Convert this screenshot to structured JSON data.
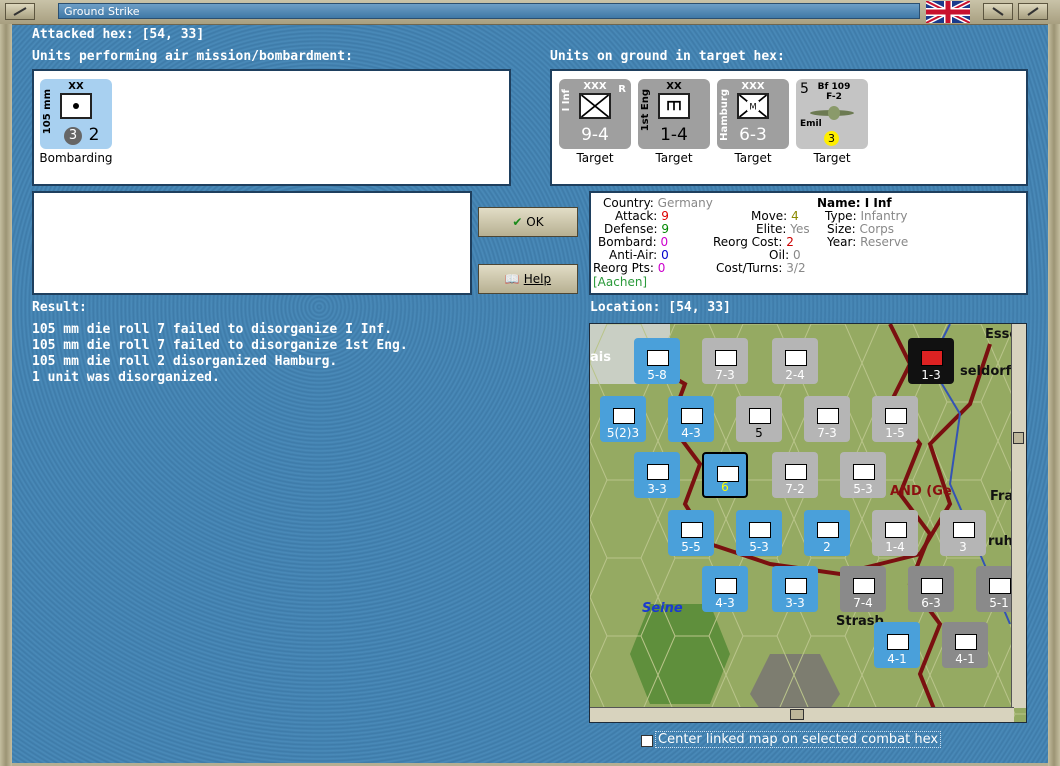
{
  "window": {
    "title": "Ground Strike"
  },
  "attacked_hex": "Attacked hex:  [54, 33]",
  "air_units_header": "Units performing air mission/bombardment:",
  "ground_units_header": "Units on ground in target hex:",
  "air_units": [
    {
      "size": "XX",
      "side_label": "105 mm",
      "value": "2",
      "badge": "3",
      "status": "Bombarding"
    }
  ],
  "ground_units": [
    {
      "size": "XXX",
      "side_label": "I Inf",
      "value": "9-4",
      "flag": "R",
      "status": "Target"
    },
    {
      "size": "XX",
      "side_label": "1st Eng",
      "value": "1-4",
      "flag": "",
      "status": "Target"
    },
    {
      "size": "XXX",
      "side_label": "Hamburg",
      "value": "6-3",
      "flag": "",
      "status": "Target"
    },
    {
      "size": "Bf 109 F-2",
      "side_label": "Emil",
      "value": "5",
      "badge": "3",
      "status": "Target"
    }
  ],
  "buttons": {
    "ok": "OK",
    "help": "Help"
  },
  "unit_info": {
    "country_label": "Country:",
    "country": "Germany",
    "attack_label": "Attack:",
    "attack": "9",
    "defense_label": "Defense:",
    "defense": "9",
    "bombard_label": "Bombard:",
    "bombard": "0",
    "antiair_label": "Anti-Air:",
    "antiair": "0",
    "reorg_pts_label": "Reorg Pts:",
    "reorg_pts": "0",
    "location_tag": "[Aachen]",
    "move_label": "Move:",
    "move": "4",
    "elite_label": "Elite:",
    "elite": "Yes",
    "reorg_cost_label": "Reorg Cost:",
    "reorg_cost": "2",
    "oil_label": "Oil:",
    "oil": "0",
    "cost_turns_label": "Cost/Turns:",
    "cost_turns": "3/2",
    "name_label": "Name:",
    "name": "I Inf",
    "type_label": "Type:",
    "type": "Infantry",
    "size_label": "Size:",
    "size": "Corps",
    "year_label": "Year:",
    "year": "Reserve"
  },
  "result": {
    "header": "Result:",
    "lines": [
      "105 mm die roll 7 failed to disorganize I Inf.",
      "105 mm die roll 7 failed to disorganize 1st Eng.",
      "105 mm die roll 2 disorganized Hamburg.",
      "1 unit was disorganized."
    ]
  },
  "location": {
    "header": "Location:  [54, 33]"
  },
  "map": {
    "labels": [
      "Essen",
      "seldorf",
      "Fra",
      "ruh",
      "Strasb",
      "Seine",
      "ais",
      "AND (Ge"
    ],
    "counters": [
      {
        "value": "5-8",
        "color": "blue"
      },
      {
        "value": "7-3",
        "color": "lgray"
      },
      {
        "value": "2-4",
        "color": "lgray"
      },
      {
        "value": "1-3",
        "color": "black"
      },
      {
        "value": "5(2)3",
        "color": "blue"
      },
      {
        "value": "4-3",
        "color": "blue"
      },
      {
        "value": "5",
        "color": "lgray"
      },
      {
        "value": "7-3",
        "color": "lgray"
      },
      {
        "value": "1-5",
        "color": "lgray"
      },
      {
        "value": "3-3",
        "color": "blue"
      },
      {
        "value": "6",
        "color": "blue"
      },
      {
        "value": "7-2",
        "color": "lgray"
      },
      {
        "value": "5-3",
        "color": "lgray"
      },
      {
        "value": "5-5",
        "color": "blue"
      },
      {
        "value": "5-3",
        "color": "blue"
      },
      {
        "value": "2",
        "color": "blue"
      },
      {
        "value": "1-4",
        "color": "lgray"
      },
      {
        "value": "3",
        "color": "lgray"
      },
      {
        "value": "4-3",
        "color": "blue"
      },
      {
        "value": "3-3",
        "color": "blue"
      },
      {
        "value": "7-4",
        "color": "gray"
      },
      {
        "value": "6-3",
        "color": "gray"
      },
      {
        "value": "5-1",
        "color": "gray"
      },
      {
        "value": "4-1",
        "color": "blue"
      },
      {
        "value": "4-1",
        "color": "gray"
      }
    ]
  },
  "center_map_label": "Center linked map on selected combat hex"
}
